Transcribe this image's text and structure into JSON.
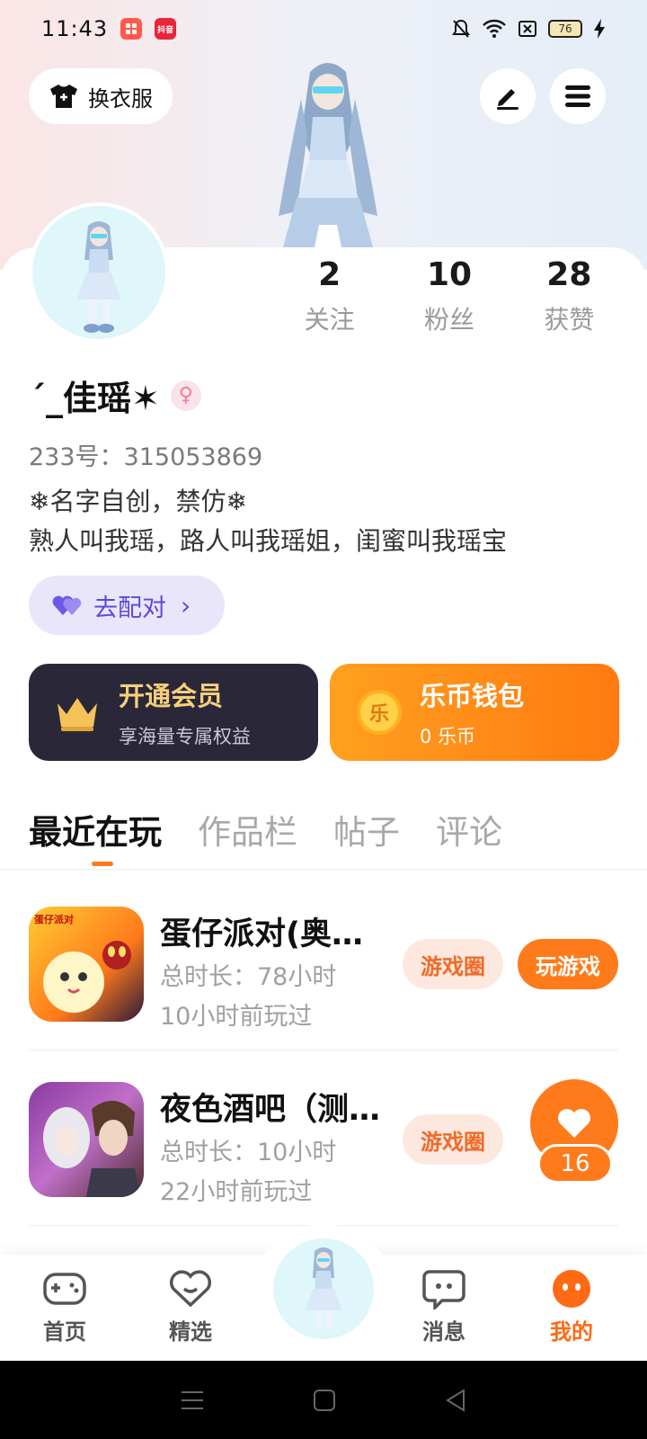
{
  "status_bar": {
    "time": "11:43",
    "app_icon_2_text": "抖音",
    "battery": "76",
    "icons": [
      "mute-bell-icon",
      "wifi-icon",
      "sim-off-icon",
      "battery-icon",
      "charging-icon"
    ]
  },
  "header": {
    "outfit_button": "换衣服",
    "edit_icon": "edit-icon",
    "menu_icon": "menu-icon"
  },
  "profile": {
    "stats": [
      {
        "value": "2",
        "label": "关注"
      },
      {
        "value": "10",
        "label": "粉丝"
      },
      {
        "value": "28",
        "label": "获赞"
      }
    ],
    "nickname": "ˊ_佳瑶✶",
    "gender_symbol": "♀",
    "uid": "233号：315053869",
    "bio_line1": "❄名字自创，禁仿❄",
    "bio_line2": "熟人叫我瑶，路人叫我瑶姐，闺蜜叫我瑶宝",
    "match_button": "去配对",
    "match_chevron": "›"
  },
  "promos": {
    "vip": {
      "title": "开通会员",
      "subtitle": "享海量专属权益"
    },
    "coin": {
      "title": "乐币钱包",
      "subtitle": "0 乐币",
      "coin_glyph": "乐"
    }
  },
  "tabs": [
    "最近在玩",
    "作品栏",
    "帖子",
    "评论"
  ],
  "games": [
    {
      "title": "蛋仔派对(奥…",
      "duration": "总时长：78小时",
      "last_played": "10小时前玩过",
      "circle_label": "游戏圈",
      "play_label": "玩游戏",
      "icon_text": "蛋仔派对"
    },
    {
      "title": "夜色酒吧（测…",
      "duration": "总时长：10小时",
      "last_played": "22小时前玩过",
      "circle_label": "游戏圈"
    }
  ],
  "like_float": {
    "count": "16"
  },
  "bottom_nav": [
    {
      "label": "首页",
      "icon": "gamepad-icon"
    },
    {
      "label": "精选",
      "icon": "heart-icon"
    },
    {
      "label": "消息",
      "icon": "chat-icon"
    },
    {
      "label": "我的",
      "icon": "profile-face-icon"
    }
  ],
  "colors": {
    "accent": "#ff7a1a",
    "match_purple": "#5a4ad9",
    "vip_dark": "#2a2838"
  }
}
